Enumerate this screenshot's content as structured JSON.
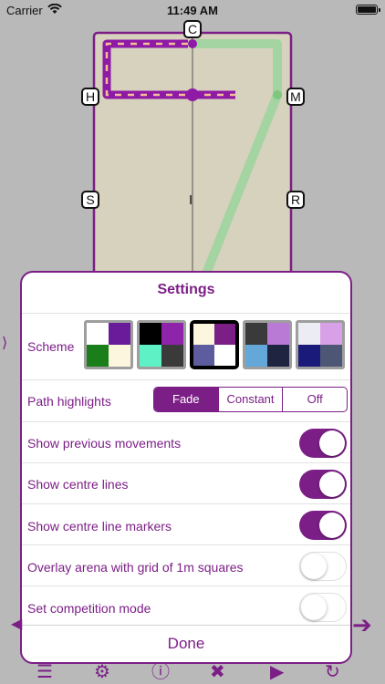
{
  "status_bar": {
    "carrier": "Carrier",
    "time": "11:49 AM"
  },
  "arena": {
    "markers": {
      "top": "C",
      "left_upper": "H",
      "right_upper": "M",
      "left_mid": "S",
      "right_mid": "R",
      "center": "I"
    }
  },
  "settings": {
    "title": "Settings",
    "scheme_label": "Scheme",
    "schemes": [
      {
        "colors": [
          "#ffffff",
          "#6a1b9a",
          "#1a7f1a",
          "#fdf6df"
        ]
      },
      {
        "colors": [
          "#000000",
          "#8e24aa",
          "#5ef1c6",
          "#3a3a3a"
        ]
      },
      {
        "colors": [
          "#fdf6df",
          "#7b1f86",
          "#5c5c9e",
          "#ffffff"
        ],
        "selected": true
      },
      {
        "colors": [
          "#3a3a3a",
          "#b87ad4",
          "#63a8d8",
          "#1f2440"
        ]
      },
      {
        "colors": [
          "#ececf5",
          "#d8a0e6",
          "#1a1a7a",
          "#4e5676"
        ]
      }
    ],
    "path_highlights_label": "Path highlights",
    "path_highlights_options": [
      "Fade",
      "Constant",
      "Off"
    ],
    "path_highlights_selected": "Fade",
    "toggles": [
      {
        "label": "Show previous movements",
        "on": true
      },
      {
        "label": "Show centre lines",
        "on": true
      },
      {
        "label": "Show centre line markers",
        "on": true
      },
      {
        "label": "Overlay arena with grid of 1m squares",
        "on": false
      },
      {
        "label": "Set competition mode",
        "on": false
      }
    ],
    "done_label": "Done"
  },
  "colors": {
    "accent": "#7b1f86",
    "arena_fill": "#d6d2bd",
    "path_green": "#9fd49f"
  }
}
